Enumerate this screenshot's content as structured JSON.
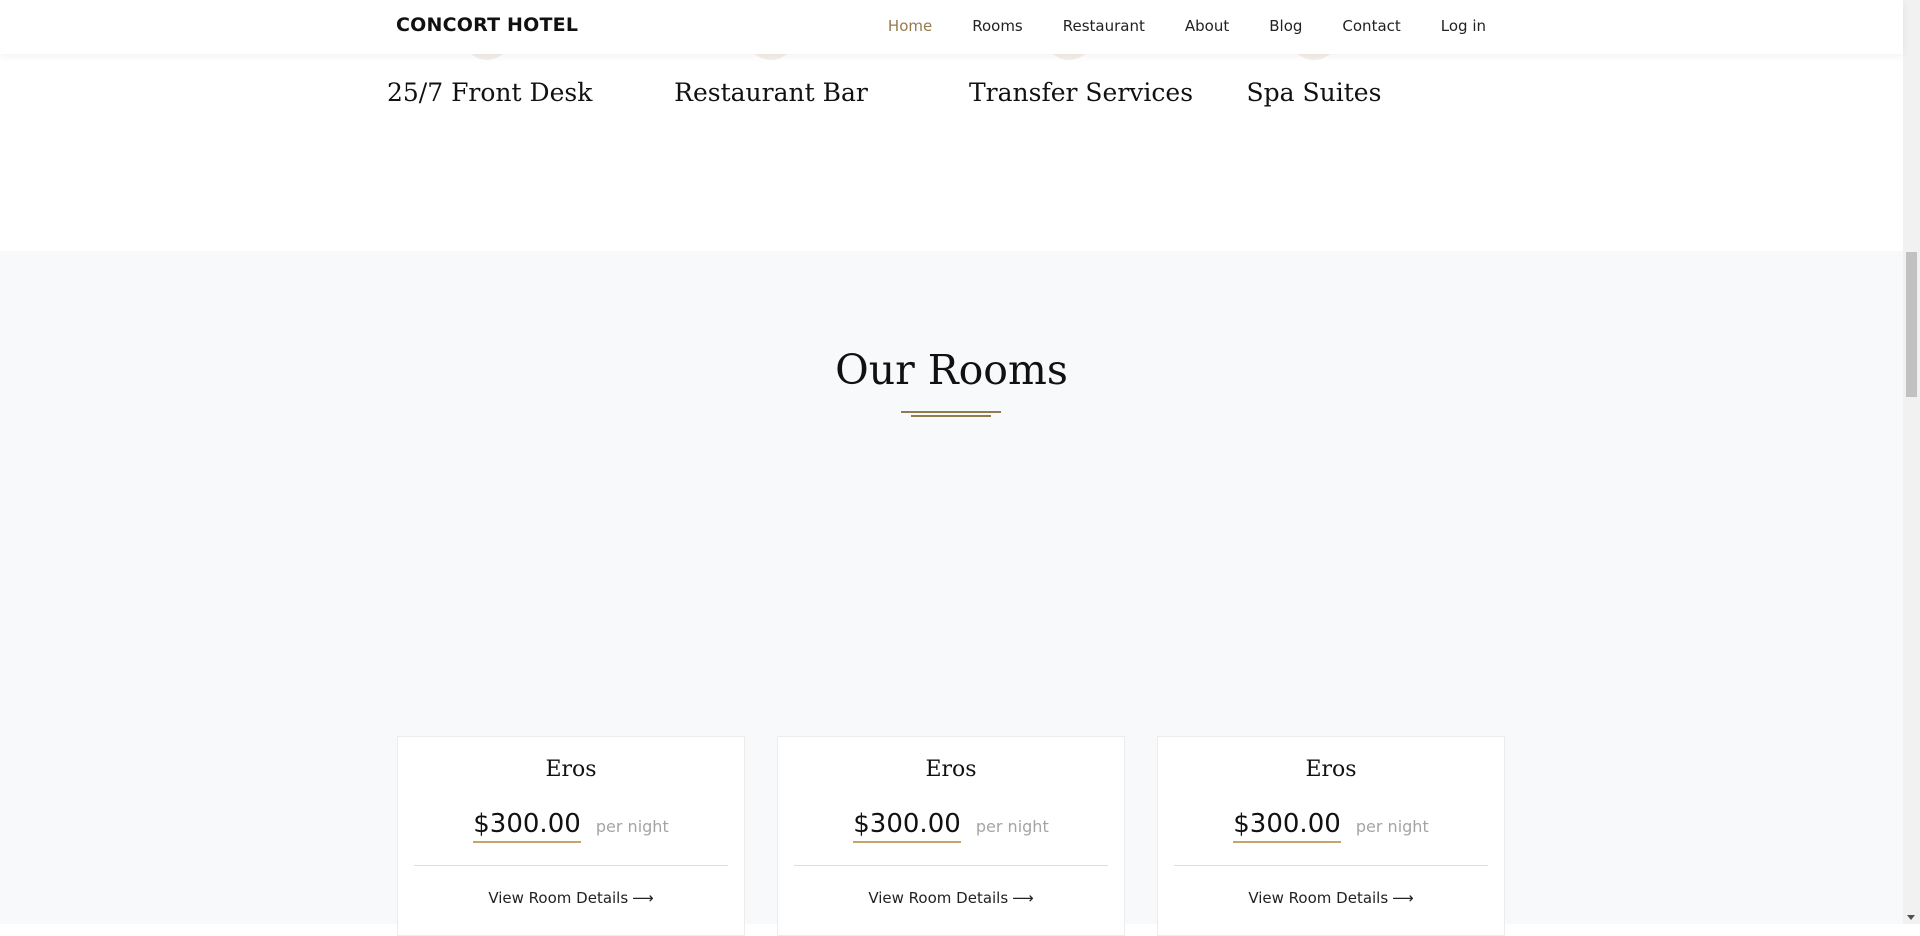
{
  "header": {
    "brand": "CONCORT HOTEL",
    "nav": [
      "Home",
      "Rooms",
      "Restaurant",
      "About",
      "Blog",
      "Contact",
      "Log in"
    ],
    "active": "Home"
  },
  "services": [
    {
      "title": "25/7 Front Desk"
    },
    {
      "title": "Restaurant Bar"
    },
    {
      "title": "Transfer Services"
    },
    {
      "title": "Spa Suites"
    }
  ],
  "rooms": {
    "title": "Our Rooms",
    "cards": [
      {
        "name": "Eros",
        "price": "$300.00",
        "unit": "per night",
        "details": "View Room Details"
      },
      {
        "name": "Eros",
        "price": "$300.00",
        "unit": "per night",
        "details": "View Room Details"
      },
      {
        "name": "Eros",
        "price": "$300.00",
        "unit": "per night",
        "details": "View Room Details"
      }
    ]
  },
  "colors": {
    "accent": "#957a50",
    "accent_light": "#c9a46a",
    "section_bg": "#f8f9fa"
  },
  "icons": {
    "arrow": "long-arrow-right-icon"
  }
}
